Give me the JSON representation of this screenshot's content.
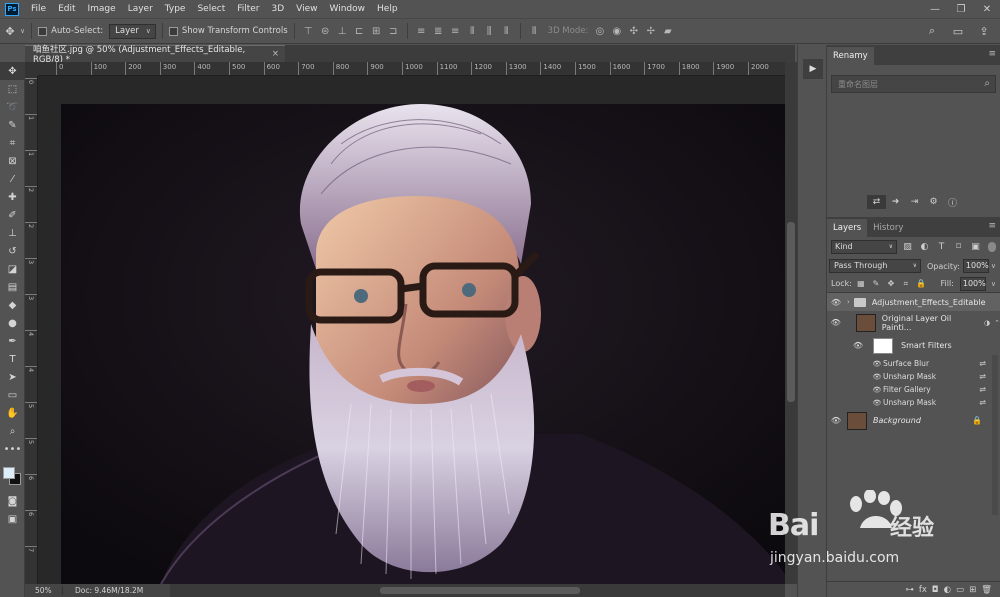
{
  "app": {
    "logo": "Ps"
  },
  "menu": [
    "File",
    "Edit",
    "Image",
    "Layer",
    "Type",
    "Select",
    "Filter",
    "3D",
    "View",
    "Window",
    "Help"
  ],
  "window_controls": [
    "minimize-icon",
    "restore-icon",
    "close-icon"
  ],
  "options_bar": {
    "auto_select_label": "Auto-Select:",
    "auto_select_value": "Layer",
    "transform_label": "Show Transform Controls",
    "mode_3d_label": "3D Mode:"
  },
  "document": {
    "tab_title": "咱鱼社区.jpg @ 50% (Adjustment_Effects_Editable, RGB/8) *",
    "close_glyph": "×"
  },
  "ruler": {
    "h_labels": [
      "0",
      "100",
      "200",
      "300",
      "400",
      "500",
      "600",
      "700",
      "800",
      "900",
      "1000",
      "1100",
      "1200",
      "1300",
      "1400",
      "1500",
      "1600",
      "1700",
      "1800",
      "1900",
      "2000"
    ],
    "v_labels": [
      "0",
      "1",
      "1",
      "2",
      "2",
      "3",
      "3",
      "4",
      "4",
      "5",
      "5",
      "6",
      "6",
      "7"
    ]
  },
  "status": {
    "zoom": "50%",
    "doc": "Doc: 9.46M/18.2M"
  },
  "renamy": {
    "tab": "Renamy",
    "search_placeholder": "重命名图层"
  },
  "layers_panel": {
    "tabs": [
      "Layers",
      "History"
    ],
    "filter_kind": "Kind",
    "blend_mode": "Pass Through",
    "opacity_label": "Opacity:",
    "opacity_value": "100%",
    "lock_label": "Lock:",
    "fill_label": "Fill:",
    "fill_value": "100%",
    "group_name": "Adjustment_Effects_Editable",
    "layer_name": "Original Layer Oil Painti...",
    "smart_filters_label": "Smart Filters",
    "filters": [
      "Surface Blur",
      "Unsharp Mask",
      "Filter Gallery",
      "Unsharp Mask"
    ],
    "background_name": "Background"
  },
  "watermark": {
    "brand": "Bai",
    "cn": "经验",
    "url": "jingyan.baidu.com"
  },
  "colors": {
    "panel_bg": "#535353",
    "canvas_bg": "#282828",
    "accent": "#31a8ff",
    "foreground_color": "#dceefa",
    "background_color": "#111111"
  }
}
